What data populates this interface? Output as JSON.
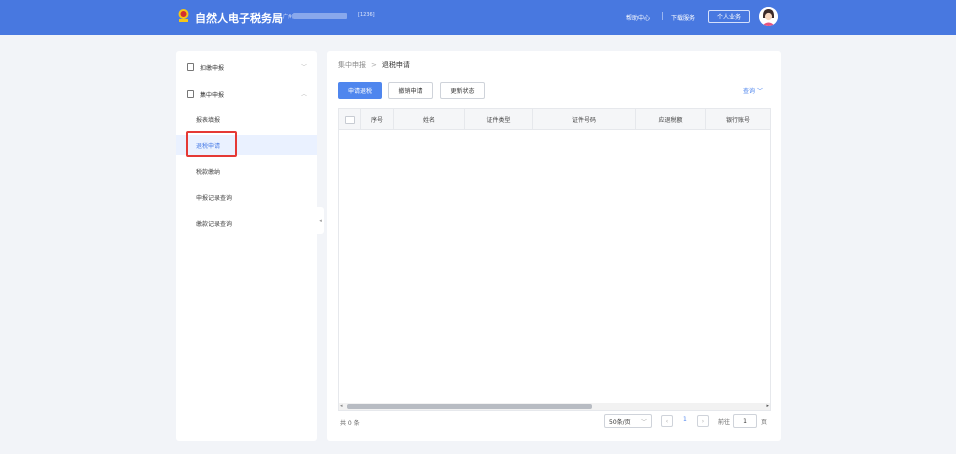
{
  "header": {
    "title": "自然人电子税务局",
    "region": "广州",
    "tax_code": "[1236]",
    "help_label": "帮助中心",
    "download_label": "下载服务",
    "personal_label": "个人业务",
    "bg_color": "#4878e0"
  },
  "sidebar": {
    "groups": [
      {
        "label": "扣缴申报",
        "icon": "document-icon",
        "expanded": false
      },
      {
        "label": "集中申报",
        "icon": "document-icon",
        "expanded": true
      }
    ],
    "items": [
      {
        "label": "报表填报"
      },
      {
        "label": "退税申请",
        "active": true
      },
      {
        "label": "税款缴纳"
      },
      {
        "label": "申报记录查询"
      },
      {
        "label": "缴款记录查询"
      }
    ]
  },
  "main": {
    "breadcrumb": {
      "parent": "集中申报",
      "sep": ">",
      "current": "退税申请"
    },
    "buttons": {
      "apply": "申请退税",
      "revoke": "撤销申请",
      "update": "更新状态"
    },
    "query_label": "查询",
    "table": {
      "columns": [
        "序号",
        "姓名",
        "证件类型",
        "证件号码",
        "应退税额",
        "银行账号"
      ],
      "rows": []
    },
    "pagination": {
      "total_text": "共 0 条",
      "page_size": "50条/页",
      "current_page": "1",
      "goto_label": "前往",
      "goto_value": "1",
      "page_unit": "页"
    }
  },
  "accent_color": "#4f86ee",
  "highlight_color": "#e53935"
}
